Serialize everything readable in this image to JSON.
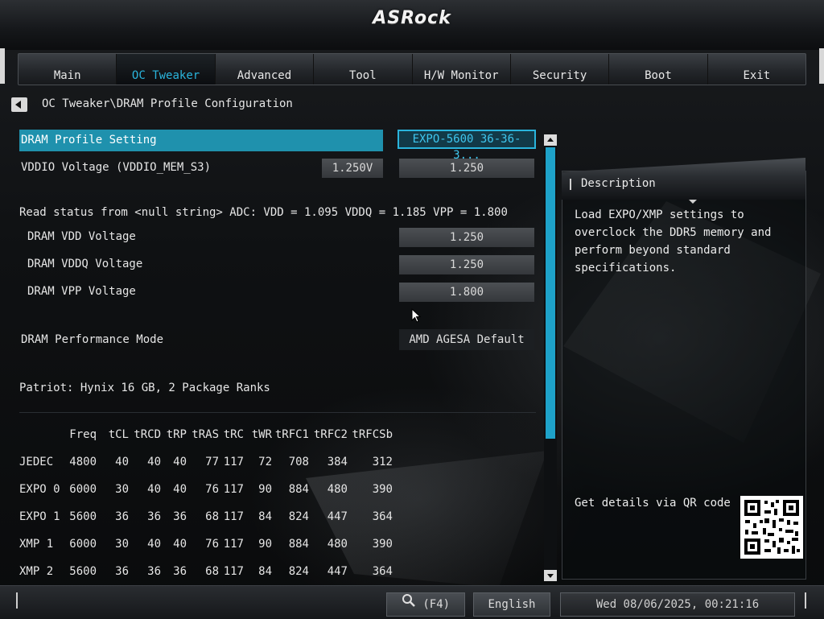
{
  "header": {
    "brand": "ASRock"
  },
  "tabs": [
    {
      "label": "Main"
    },
    {
      "label": "OC Tweaker",
      "active": true
    },
    {
      "label": "Advanced"
    },
    {
      "label": "Tool"
    },
    {
      "label": "H/W Monitor"
    },
    {
      "label": "Security"
    },
    {
      "label": "Boot"
    },
    {
      "label": "Exit"
    }
  ],
  "breadcrumb": "OC Tweaker\\DRAM Profile Configuration",
  "settings": {
    "dram_profile": {
      "label": "DRAM Profile Setting",
      "value": "EXPO-5600 36-36-3..."
    },
    "vddio": {
      "label": "VDDIO Voltage (VDDIO_MEM_S3)",
      "current": "1.250V",
      "value": "1.250"
    },
    "read_status": "Read status from <null string> ADC: VDD = 1.095 VDDQ = 1.185 VPP = 1.800",
    "dram_vdd": {
      "label": "DRAM VDD Voltage",
      "value": "1.250"
    },
    "dram_vddq": {
      "label": "DRAM VDDQ Voltage",
      "value": "1.250"
    },
    "dram_vpp": {
      "label": "DRAM VPP Voltage",
      "value": "1.800"
    },
    "perf_mode": {
      "label": "DRAM Performance Mode",
      "value": "AMD AGESA Default"
    },
    "module_info": "Patriot: Hynix 16 GB, 2 Package Ranks"
  },
  "timing_table": {
    "headers": [
      "",
      "Freq",
      "tCL",
      "tRCD",
      "tRP",
      "tRAS",
      "tRC",
      "tWR",
      "tRFC1",
      "tRFC2",
      "tRFCSb"
    ],
    "rows": [
      [
        "JEDEC",
        "4800",
        "40",
        "40",
        "40",
        "77",
        "117",
        "72",
        "708",
        "384",
        "312"
      ],
      [
        "EXPO 0",
        "6000",
        "30",
        "40",
        "40",
        "76",
        "117",
        "90",
        "884",
        "480",
        "390"
      ],
      [
        "EXPO 1",
        "5600",
        "36",
        "36",
        "36",
        "68",
        "117",
        "84",
        "824",
        "447",
        "364"
      ],
      [
        "XMP 1",
        "6000",
        "30",
        "40",
        "40",
        "76",
        "117",
        "90",
        "884",
        "480",
        "390"
      ],
      [
        "XMP 2",
        "5600",
        "36",
        "36",
        "36",
        "68",
        "117",
        "84",
        "824",
        "447",
        "364"
      ]
    ]
  },
  "description": {
    "title": "Description",
    "text": "Load EXPO/XMP settings to\noverclock the DDR5 memory and\nperform beyond standard\nspecifications.",
    "qr_label": "Get details via QR code"
  },
  "footer": {
    "search_hint": "(F4)",
    "language": "English",
    "datetime": "Wed 08/06/2025, 00:21:16"
  },
  "colors": {
    "accent": "#1ea2c9",
    "highlight": "#1f91ad",
    "active_tab": "#2ab4dc"
  }
}
